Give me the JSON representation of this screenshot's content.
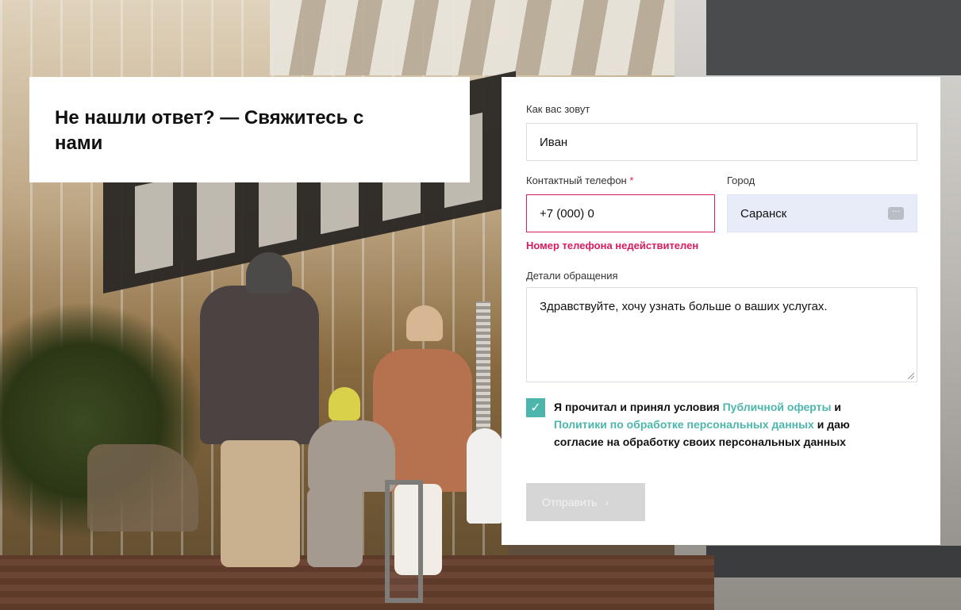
{
  "title_card": {
    "title": "Не нашли ответ? — Свяжитесь с нами"
  },
  "form": {
    "name": {
      "label": "Как вас зовут",
      "value": "Иван"
    },
    "phone": {
      "label": "Контактный телефон",
      "required_mark": "*",
      "value": "+7 (000) 0",
      "error": "Номер телефона недействителен"
    },
    "city": {
      "label": "Город",
      "value": "Саранск",
      "icon": "dots-icon"
    },
    "details": {
      "label": "Детали обращения",
      "value": "Здравствуйте, хочу узнать больше о ваших услугах."
    },
    "consent": {
      "checked": true,
      "text_before": "Я прочитал и принял условия ",
      "link1": "Публичной оферты",
      "text_mid": " и ",
      "link2": "Политики по обработке персональных данных",
      "text_after": " и даю согласие на обработку своих персональных данных"
    },
    "submit": {
      "label": "Отправить",
      "icon": "chevron-right-icon"
    }
  },
  "colors": {
    "accent": "#4db6ac",
    "error": "#d81b60",
    "disabled_button": "#d6d6d6"
  }
}
